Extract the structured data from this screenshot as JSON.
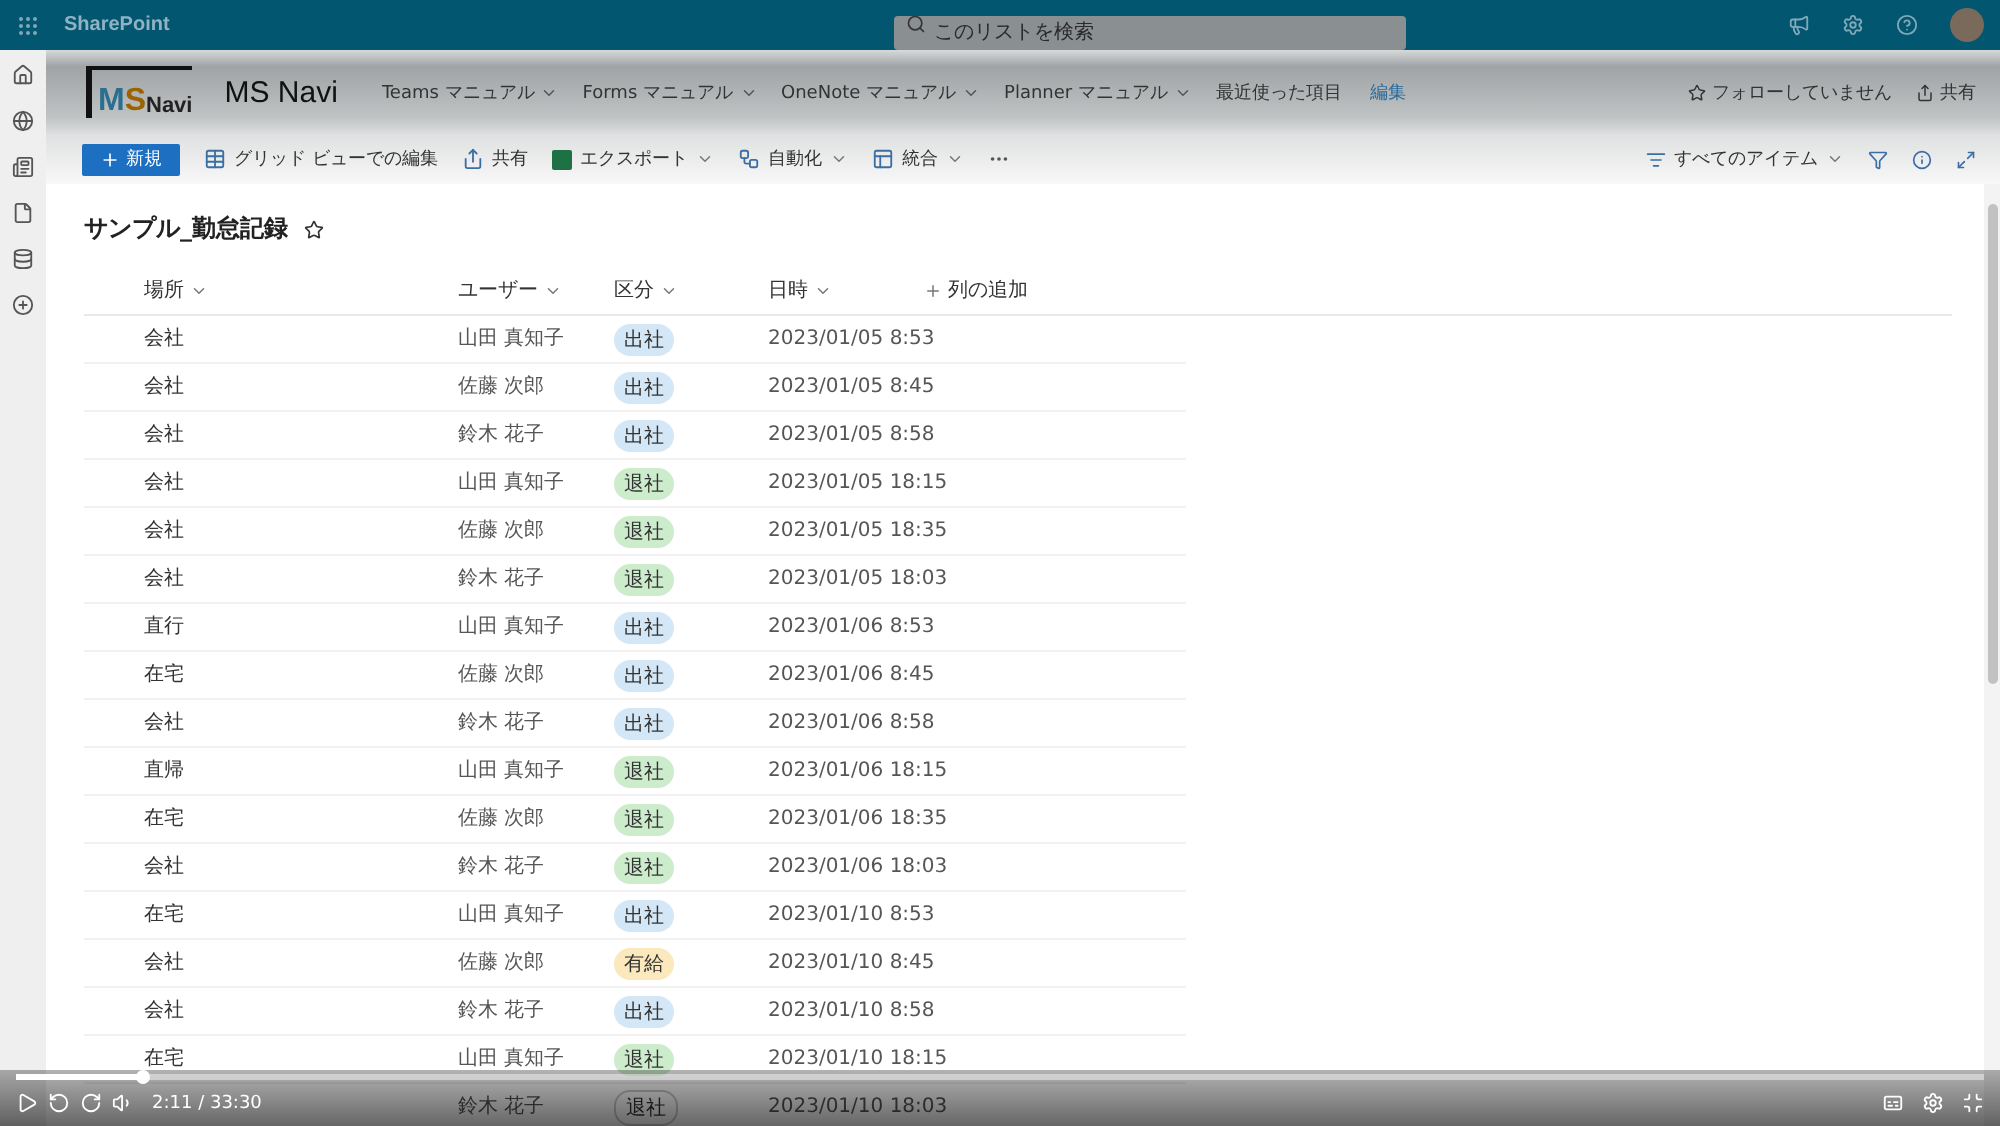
{
  "suite_bar": {
    "app_name": "SharePoint",
    "search": {
      "placeholder": "このリストを検索"
    }
  },
  "site_header": {
    "logo": [
      {
        "text": "M",
        "color": "#2a6f8f"
      },
      {
        "text": "S",
        "color": "#9a6200"
      },
      {
        "text": "Navi",
        "color": "#222222"
      }
    ],
    "title": "MS Navi",
    "nav": [
      {
        "label": "Teams マニュアル",
        "has_menu": true
      },
      {
        "label": "Forms マニュアル",
        "has_menu": true
      },
      {
        "label": "OneNote マニュアル",
        "has_menu": true
      },
      {
        "label": "Planner マニュアル",
        "has_menu": true
      },
      {
        "label": "最近使った項目",
        "has_menu": false
      }
    ],
    "edit_link": "編集",
    "follow": "フォローしていません",
    "share": "共有"
  },
  "command_bar": {
    "new": "新規",
    "commands": [
      {
        "kind": "grid",
        "label": "グリッド ビューでの編集",
        "has_menu": false
      },
      {
        "kind": "share",
        "label": "共有",
        "has_menu": false
      },
      {
        "kind": "excel",
        "label": "エクスポート",
        "has_menu": true
      },
      {
        "kind": "automate",
        "label": "自動化",
        "has_menu": true
      },
      {
        "kind": "integrate",
        "label": "統合",
        "has_menu": true
      }
    ],
    "view": "すべてのアイテム"
  },
  "list": {
    "title": "サンプル_勤怠記録",
    "columns": [
      "場所",
      "ユーザー",
      "区分",
      "日時"
    ],
    "add_column": "列の追加",
    "rows": [
      {
        "place": "会社",
        "user": "山田 真知子",
        "status": {
          "label": "出社",
          "color": "#d3e7f7"
        },
        "datetime": "2023/01/05 8:53"
      },
      {
        "place": "会社",
        "user": "佐藤 次郎",
        "status": {
          "label": "出社",
          "color": "#d3e7f7"
        },
        "datetime": "2023/01/05 8:45"
      },
      {
        "place": "会社",
        "user": "鈴木 花子",
        "status": {
          "label": "出社",
          "color": "#d3e7f7"
        },
        "datetime": "2023/01/05 8:58"
      },
      {
        "place": "会社",
        "user": "山田 真知子",
        "status": {
          "label": "退社",
          "color": "#cdeccc"
        },
        "datetime": "2023/01/05 18:15"
      },
      {
        "place": "会社",
        "user": "佐藤 次郎",
        "status": {
          "label": "退社",
          "color": "#cdeccc"
        },
        "datetime": "2023/01/05 18:35"
      },
      {
        "place": "会社",
        "user": "鈴木 花子",
        "status": {
          "label": "退社",
          "color": "#cdeccc"
        },
        "datetime": "2023/01/05 18:03"
      },
      {
        "place": "直行",
        "user": "山田 真知子",
        "status": {
          "label": "出社",
          "color": "#d3e7f7"
        },
        "datetime": "2023/01/06 8:53"
      },
      {
        "place": "在宅",
        "user": "佐藤 次郎",
        "status": {
          "label": "出社",
          "color": "#d3e7f7"
        },
        "datetime": "2023/01/06 8:45"
      },
      {
        "place": "会社",
        "user": "鈴木 花子",
        "status": {
          "label": "出社",
          "color": "#d3e7f7"
        },
        "datetime": "2023/01/06 8:58"
      },
      {
        "place": "直帰",
        "user": "山田 真知子",
        "status": {
          "label": "退社",
          "color": "#cdeccc"
        },
        "datetime": "2023/01/06 18:15"
      },
      {
        "place": "在宅",
        "user": "佐藤 次郎",
        "status": {
          "label": "退社",
          "color": "#cdeccc"
        },
        "datetime": "2023/01/06 18:35"
      },
      {
        "place": "会社",
        "user": "鈴木 花子",
        "status": {
          "label": "退社",
          "color": "#cdeccc"
        },
        "datetime": "2023/01/06 18:03"
      },
      {
        "place": "在宅",
        "user": "山田 真知子",
        "status": {
          "label": "出社",
          "color": "#d3e7f7"
        },
        "datetime": "2023/01/10 8:53"
      },
      {
        "place": "会社",
        "user": "佐藤 次郎",
        "status": {
          "label": "有給",
          "color": "#fbe9bd"
        },
        "datetime": "2023/01/10 8:45"
      },
      {
        "place": "会社",
        "user": "鈴木 花子",
        "status": {
          "label": "出社",
          "color": "#d3e7f7"
        },
        "datetime": "2023/01/10 8:58"
      },
      {
        "place": "在宅",
        "user": "山田 真知子",
        "status": {
          "label": "退社",
          "color": "#cdeccc"
        },
        "datetime": "2023/01/10 18:15"
      },
      {
        "user": "鈴木 花子",
        "status": {
          "label": "退社"
        },
        "datetime": "2023/01/10 18:03"
      }
    ]
  },
  "player": {
    "progress": {
      "level": 0.065
    },
    "time": "2:11 / 33:30"
  }
}
